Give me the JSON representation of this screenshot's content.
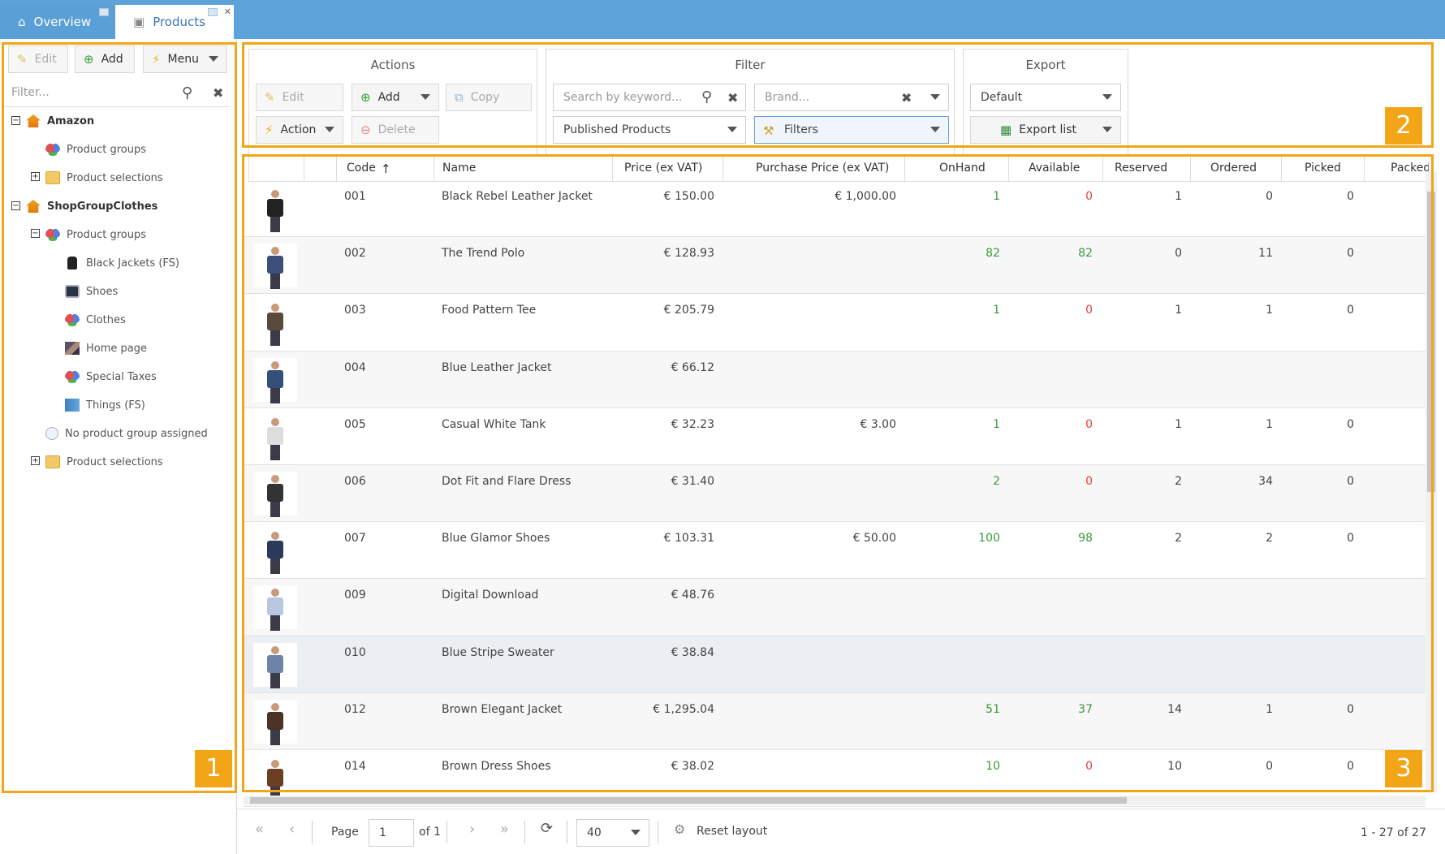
{
  "tabs": [
    {
      "label": "Overview",
      "icon": "home-icon"
    },
    {
      "label": "Products",
      "icon": "box-icon"
    }
  ],
  "left_pane": {
    "edit_label": "Edit",
    "add_label": "Add",
    "menu_label": "Menu",
    "filter_placeholder": "Filter...",
    "tree": [
      {
        "label": "Amazon",
        "bold": true
      },
      {
        "label": "Product groups"
      },
      {
        "label": "Product selections"
      },
      {
        "label": "ShopGroupClothes",
        "bold": true
      },
      {
        "label": "Product groups"
      },
      {
        "label": "Black Jackets (FS)"
      },
      {
        "label": "Shoes"
      },
      {
        "label": "Clothes"
      },
      {
        "label": "Home page"
      },
      {
        "label": "Special Taxes"
      },
      {
        "label": "Things (FS)"
      },
      {
        "label": "No product group assigned"
      },
      {
        "label": "Product selections"
      }
    ]
  },
  "toolbar": {
    "actions": {
      "title": "Actions",
      "edit_label": "Edit",
      "add_label": "Add",
      "copy_label": "Copy",
      "action_label": "Action",
      "delete_label": "Delete"
    },
    "filter": {
      "title": "Filter",
      "search_placeholder": "Search by keyword...",
      "brand_placeholder": "Brand...",
      "published_value": "Published Products",
      "filters_label": "Filters"
    },
    "export": {
      "title": "Export",
      "layout_value": "Default",
      "export_label": "Export list"
    }
  },
  "grid": {
    "columns": [
      "Code",
      "Name",
      "Price (ex VAT)",
      "Purchase Price (ex VAT)",
      "OnHand",
      "Available",
      "Reserved",
      "Ordered",
      "Picked",
      "Packed"
    ],
    "rows": [
      {
        "code": "001",
        "name": "Black Rebel Leather Jacket",
        "price": "€ 150.00",
        "purchase": "€ 1,000.00",
        "onhand": "1",
        "available": "0",
        "reserved": "1",
        "ordered": "0",
        "picked": "0",
        "color": "#222222"
      },
      {
        "code": "002",
        "name": "The Trend Polo",
        "price": "€ 128.93",
        "purchase": "",
        "onhand": "82",
        "available": "82",
        "reserved": "0",
        "ordered": "11",
        "picked": "0",
        "color": "#3b4f7a"
      },
      {
        "code": "003",
        "name": "Food Pattern Tee",
        "price": "€ 205.79",
        "purchase": "",
        "onhand": "1",
        "available": "0",
        "reserved": "1",
        "ordered": "1",
        "picked": "0",
        "color": "#5a4a3a"
      },
      {
        "code": "004",
        "name": "Blue Leather Jacket",
        "price": "€ 66.12",
        "purchase": "",
        "onhand": "",
        "available": "",
        "reserved": "",
        "ordered": "",
        "picked": "",
        "color": "#34507a"
      },
      {
        "code": "005",
        "name": "Casual White Tank",
        "price": "€ 32.23",
        "purchase": "€ 3.00",
        "onhand": "1",
        "available": "0",
        "reserved": "1",
        "ordered": "1",
        "picked": "0",
        "color": "#dddddd"
      },
      {
        "code": "006",
        "name": "Dot Fit and Flare Dress",
        "price": "€ 31.40",
        "purchase": "",
        "onhand": "2",
        "available": "0",
        "reserved": "2",
        "ordered": "34",
        "picked": "0",
        "color": "#333333"
      },
      {
        "code": "007",
        "name": "Blue Glamor Shoes",
        "price": "€ 103.31",
        "purchase": "€ 50.00",
        "onhand": "100",
        "available": "98",
        "reserved": "2",
        "ordered": "2",
        "picked": "0",
        "color": "#2a3a5a"
      },
      {
        "code": "009",
        "name": "Digital Download",
        "price": "€ 48.76",
        "purchase": "",
        "onhand": "",
        "available": "",
        "reserved": "",
        "ordered": "",
        "picked": "",
        "color": "#b7c8e0"
      },
      {
        "code": "010",
        "name": "Blue Stripe Sweater",
        "price": "€ 38.84",
        "purchase": "",
        "onhand": "",
        "available": "",
        "reserved": "",
        "ordered": "",
        "picked": "",
        "color": "#6d86a8"
      },
      {
        "code": "012",
        "name": "Brown Elegant Jacket",
        "price": "€ 1,295.04",
        "purchase": "",
        "onhand": "51",
        "available": "37",
        "reserved": "14",
        "ordered": "1",
        "picked": "0",
        "color": "#4a3428"
      },
      {
        "code": "014",
        "name": "Brown Dress Shoes",
        "price": "€ 38.02",
        "purchase": "",
        "onhand": "10",
        "available": "0",
        "reserved": "10",
        "ordered": "0",
        "picked": "0",
        "color": "#6b3f22"
      }
    ]
  },
  "pager": {
    "page_label": "Page",
    "page_value": "1",
    "of_label": "of 1",
    "page_size": "40",
    "reset_label": "Reset layout",
    "range_text": "1 - 27 of 27"
  },
  "annotations": [
    "1",
    "2",
    "3"
  ],
  "colors": {
    "topbar": "#5da3d9",
    "annotation": "#f2a516",
    "positive": "#3a9a3a",
    "negative": "#e04040"
  }
}
